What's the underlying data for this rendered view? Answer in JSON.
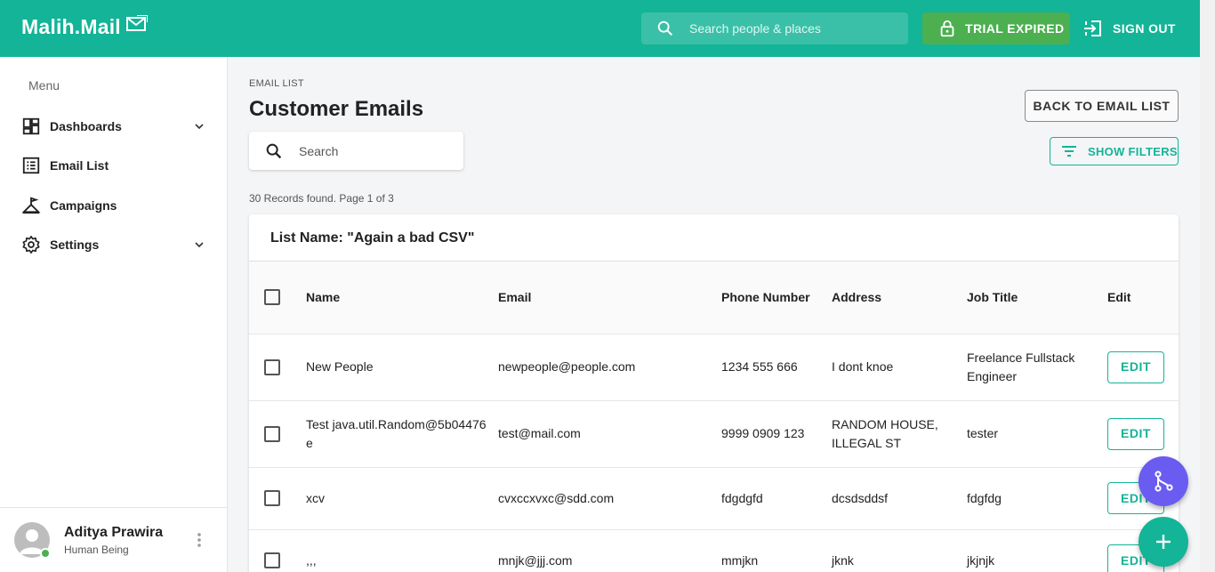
{
  "app": {
    "name": "Malih.Mail"
  },
  "header": {
    "search_placeholder": "Search people & places",
    "trial_label": "TRIAL EXPIRED",
    "signout_label": "SIGN OUT"
  },
  "sidebar": {
    "menu_title": "Menu",
    "items": [
      {
        "label": "Dashboards",
        "icon": "dashboard-icon"
      },
      {
        "label": "Email List",
        "icon": "list-icon"
      },
      {
        "label": "Campaigns",
        "icon": "campaign-icon"
      },
      {
        "label": "Settings",
        "icon": "gear-icon"
      }
    ],
    "user": {
      "name": "Aditya Prawira",
      "role": "Human Being"
    }
  },
  "page": {
    "breadcrumb": "EMAIL LIST",
    "title": "Customer Emails",
    "back_label": "BACK TO EMAIL LIST",
    "search_placeholder": "Search",
    "filters_label": "SHOW FILTERS",
    "records_text": "30 Records found. Page 1 of 3",
    "list_name": "List Name: \"Again a bad CSV\""
  },
  "table": {
    "columns": [
      "Name",
      "Email",
      "Phone Number",
      "Address",
      "Job Title",
      "Edit"
    ],
    "edit_label": "EDIT",
    "rows": [
      {
        "name": "New People",
        "email": "newpeople@people.com",
        "phone": "1234 555 666",
        "address": "I dont knoe",
        "job": "Freelance Fullstack Engineer"
      },
      {
        "name": "Test java.util.Random@5b04476e",
        "email": "test@mail.com",
        "phone": "9999 0909 123",
        "address": "RANDOM HOUSE, ILLEGAL ST",
        "job": "tester"
      },
      {
        "name": "xcv",
        "email": "cvxccxvxc@sdd.com",
        "phone": "fdgdgfd",
        "address": "dcsdsddsf",
        "job": "fdgfdg"
      },
      {
        "name": ",,,",
        "email": "mnjk@jjj.com",
        "phone": "mmjkn",
        "address": "jknk",
        "job": "jkjnjk"
      }
    ]
  },
  "colors": {
    "primary": "#13b497",
    "trial": "#4caf50",
    "fab_purple": "#6a5cf0"
  }
}
